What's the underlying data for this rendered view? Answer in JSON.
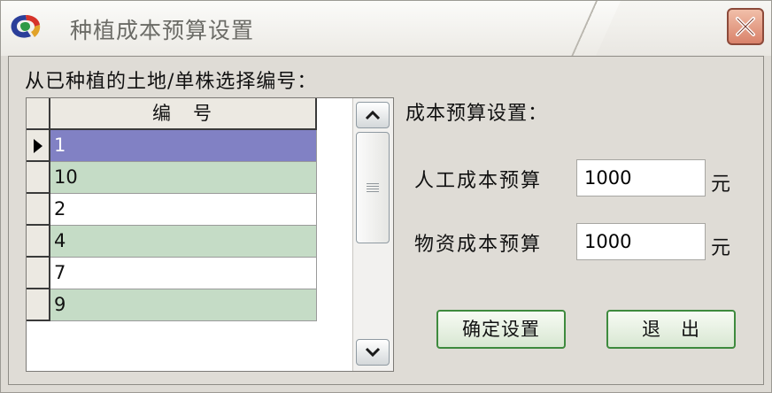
{
  "window": {
    "title": "种植成本预算设置"
  },
  "list": {
    "label": "从已种植的土地/单株选择编号：",
    "column_header": "编　号",
    "rows": [
      "1",
      "10",
      "2",
      "4",
      "7",
      "9"
    ],
    "selected_index": 0
  },
  "settings": {
    "heading": "成本预算设置：",
    "labor": {
      "label": "人工成本预算",
      "value": "1000",
      "unit": "元"
    },
    "material": {
      "label": "物资成本预算",
      "value": "1000",
      "unit": "元"
    }
  },
  "buttons": {
    "confirm": "确定设置",
    "exit": "退　出"
  },
  "colors": {
    "selected_row": "#8181c4",
    "alt_row": "#c5dcc6",
    "close_button": "#d9826a",
    "button_border": "#3e8a3e"
  }
}
